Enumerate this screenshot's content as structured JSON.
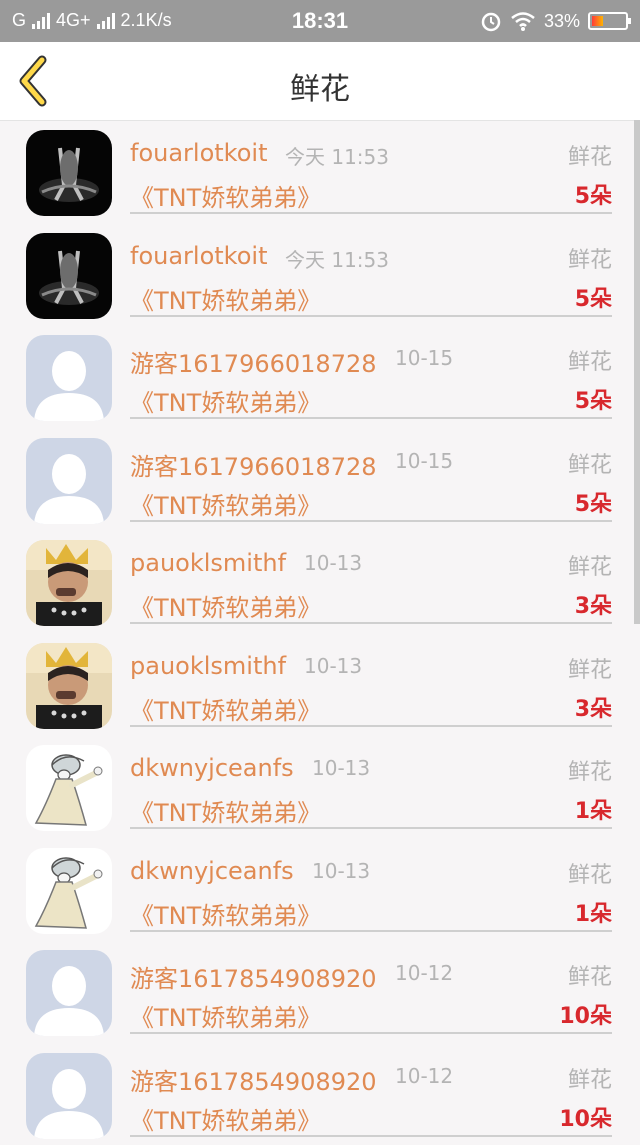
{
  "status_bar": {
    "carrier_left": "G",
    "network": "4G+",
    "speed": "2.1K/s",
    "time": "18:31",
    "battery": "33%",
    "battery_level": 0.33
  },
  "header": {
    "title": "鲜花",
    "back_icon": "chevron-left-icon"
  },
  "rows": [
    {
      "name": "fouarlotkoit",
      "time": "今天 11:53",
      "kind": "鲜花",
      "work": "《TNT娇软弟弟》",
      "count": "5朵",
      "avatar": "dark-silhouette"
    },
    {
      "name": "fouarlotkoit",
      "time": "今天 11:53",
      "kind": "鲜花",
      "work": "《TNT娇软弟弟》",
      "count": "5朵",
      "avatar": "dark-silhouette"
    },
    {
      "name": "游客1617966018728",
      "time": "10-15",
      "kind": "鲜花",
      "work": "《TNT娇软弟弟》",
      "count": "5朵",
      "avatar": "default"
    },
    {
      "name": "游客1617966018728",
      "time": "10-15",
      "kind": "鲜花",
      "work": "《TNT娇软弟弟》",
      "count": "5朵",
      "avatar": "default"
    },
    {
      "name": "pauoklsmithf",
      "time": "10-13",
      "kind": "鲜花",
      "work": "《TNT娇软弟弟》",
      "count": "3朵",
      "avatar": "photo"
    },
    {
      "name": "pauoklsmithf",
      "time": "10-13",
      "kind": "鲜花",
      "work": "《TNT娇软弟弟》",
      "count": "3朵",
      "avatar": "photo"
    },
    {
      "name": "dkwnyjceanfs",
      "time": "10-13",
      "kind": "鲜花",
      "work": "《TNT娇软弟弟》",
      "count": "1朵",
      "avatar": "cartoon"
    },
    {
      "name": "dkwnyjceanfs",
      "time": "10-13",
      "kind": "鲜花",
      "work": "《TNT娇软弟弟》",
      "count": "1朵",
      "avatar": "cartoon"
    },
    {
      "name": "游客1617854908920",
      "time": "10-12",
      "kind": "鲜花",
      "work": "《TNT娇软弟弟》",
      "count": "10朵",
      "avatar": "default"
    },
    {
      "name": "游客1617854908920",
      "time": "10-12",
      "kind": "鲜花",
      "work": "《TNT娇软弟弟》",
      "count": "10朵",
      "avatar": "default"
    }
  ]
}
